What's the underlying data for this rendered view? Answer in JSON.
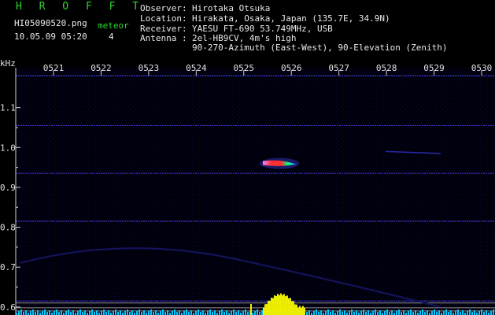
{
  "header": {
    "program": "H R O F F T",
    "filename": "HI05090520.png",
    "timestamp": "10.05.09 05:20",
    "counter_label": "meteor",
    "counter_value": "4",
    "observer_label": "Observer",
    "observer_value": "Hirotaka Otsuka",
    "location_label": "Location",
    "location_value": "Hirakata, Osaka, Japan (135.7E, 34.9N)",
    "receiver_label": "Receiver",
    "receiver_value": "YAESU FT-690 53.749MHz, USB",
    "antenna_label": "Antenna",
    "antenna_value_1": "2el-HB9CV, 4m's high",
    "antenna_value_2": "90-270-Azimuth (East-West), 90-Elevation (Zenith)"
  },
  "chart_data": {
    "type": "heatmap",
    "ylabel": "kHz",
    "x_ticks": [
      "0521",
      "0522",
      "0523",
      "0524",
      "0525",
      "0526",
      "0527",
      "0528",
      "0529",
      "0530"
    ],
    "y_ticks": [
      "1.1",
      "1.0",
      "0.9",
      "0.8",
      "0.7",
      "0.6"
    ],
    "ylim": [
      0.58,
      1.2
    ],
    "horizontal_lines_khz": [
      1.18,
      1.055,
      0.935,
      0.815,
      0.615
    ],
    "meteor_echo": {
      "time_start": "0525.4",
      "time_end": "0526.1",
      "freq_khz": 0.96
    },
    "background_color": "#000010",
    "signal_colors": [
      "#1010a0",
      "#40a0ff",
      "#00ff80",
      "#ff3030",
      "#ff80ff"
    ],
    "histogram_color": "#f0f000",
    "noise_floor_color": "#00c8ff"
  }
}
